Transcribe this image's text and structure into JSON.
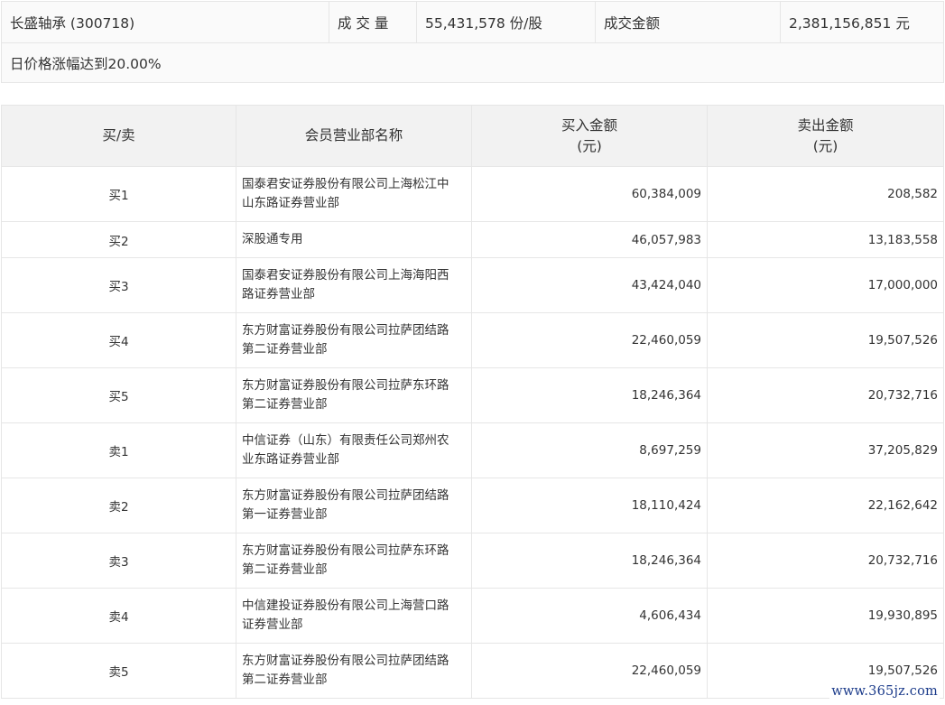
{
  "summary": {
    "stock": "长盛轴承 (300718)",
    "volume_label": "成 交 量",
    "volume_value": "55,431,578 份/股",
    "amount_label": "成交金额",
    "amount_value": "2,381,156,851 元",
    "reason": "日价格涨幅达到20.00%"
  },
  "table": {
    "headers": {
      "type": "买/卖",
      "name": "会员营业部名称",
      "buy_line1": "买入金额",
      "buy_line2": "(元)",
      "sell_line1": "卖出金额",
      "sell_line2": "(元)"
    },
    "rows": [
      {
        "type": "买1",
        "name_l1": "国泰君安证券股份有限公司上海松江中",
        "name_l2": "山东路证券营业部",
        "buy": "60,384,009",
        "sell": "208,582"
      },
      {
        "type": "买2",
        "name_l1": "深股通专用",
        "name_l2": "",
        "buy": "46,057,983",
        "sell": "13,183,558"
      },
      {
        "type": "买3",
        "name_l1": "国泰君安证券股份有限公司上海海阳西",
        "name_l2": "路证券营业部",
        "buy": "43,424,040",
        "sell": "17,000,000"
      },
      {
        "type": "买4",
        "name_l1": "东方财富证券股份有限公司拉萨团结路",
        "name_l2": "第二证券营业部",
        "buy": "22,460,059",
        "sell": "19,507,526"
      },
      {
        "type": "买5",
        "name_l1": "东方财富证券股份有限公司拉萨东环路",
        "name_l2": "第二证券营业部",
        "buy": "18,246,364",
        "sell": "20,732,716"
      },
      {
        "type": "卖1",
        "name_l1": "中信证券（山东）有限责任公司郑州农",
        "name_l2": "业东路证券营业部",
        "buy": "8,697,259",
        "sell": "37,205,829"
      },
      {
        "type": "卖2",
        "name_l1": "东方财富证券股份有限公司拉萨团结路",
        "name_l2": "第一证券营业部",
        "buy": "18,110,424",
        "sell": "22,162,642"
      },
      {
        "type": "卖3",
        "name_l1": "东方财富证券股份有限公司拉萨东环路",
        "name_l2": "第二证券营业部",
        "buy": "18,246,364",
        "sell": "20,732,716"
      },
      {
        "type": "卖4",
        "name_l1": "中信建投证券股份有限公司上海营口路",
        "name_l2": "证券营业部",
        "buy": "4,606,434",
        "sell": "19,930,895"
      },
      {
        "type": "卖5",
        "name_l1": "东方财富证券股份有限公司拉萨团结路",
        "name_l2": "第二证券营业部",
        "buy": "22,460,059",
        "sell": "19,507,526"
      }
    ]
  },
  "watermark": "www.365jz.com"
}
